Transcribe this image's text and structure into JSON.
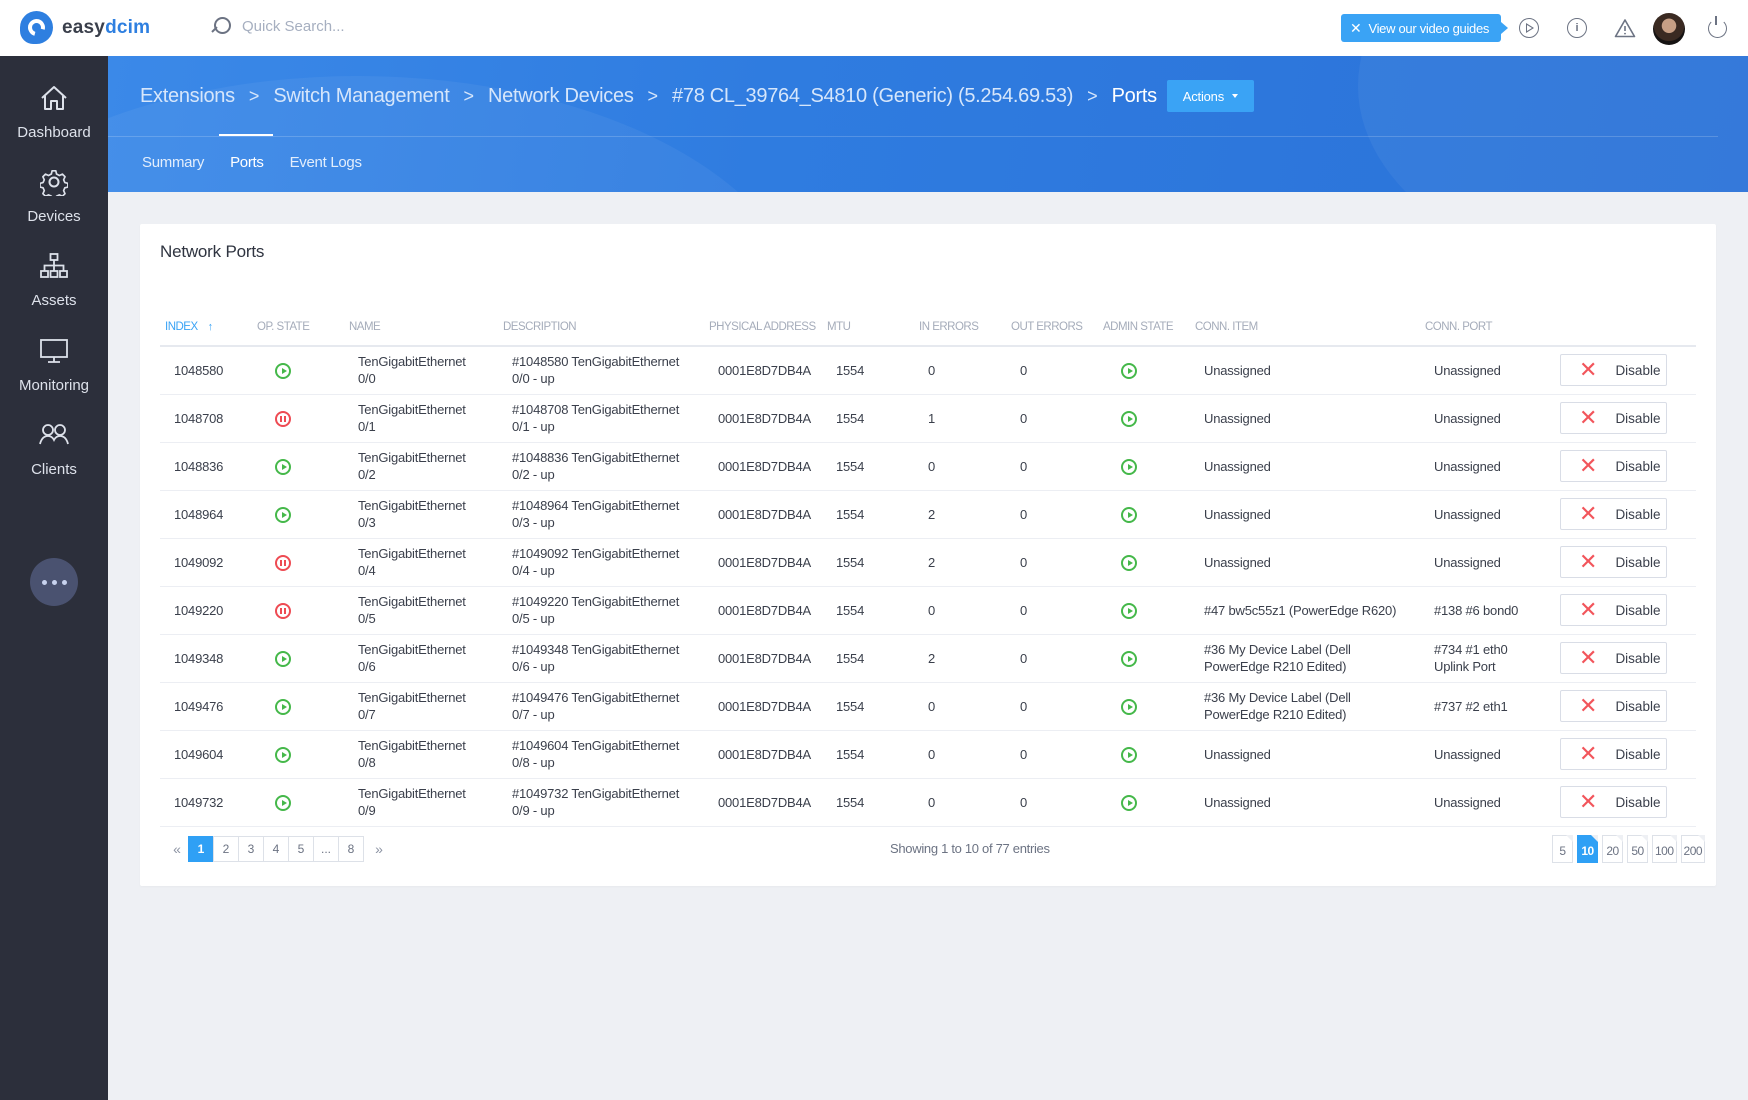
{
  "app": {
    "logo_text_a": "easy",
    "logo_text_b": "dcim",
    "search_placeholder": "Quick Search...",
    "guide_bubble": "View our video guides"
  },
  "sidebar": {
    "items": [
      {
        "label": "Dashboard",
        "icon": "home-icon"
      },
      {
        "label": "Devices",
        "icon": "gear-icon"
      },
      {
        "label": "Assets",
        "icon": "hierarchy-icon"
      },
      {
        "label": "Monitoring",
        "icon": "monitor-icon"
      },
      {
        "label": "Clients",
        "icon": "users-icon"
      }
    ],
    "more_icon": "more-dots-icon"
  },
  "breadcrumb": [
    "Extensions",
    "Switch Management",
    "Network Devices",
    "#78 CL_39764_S4810 (Generic) (5.254.69.53)",
    "Ports"
  ],
  "actions_label": "Actions",
  "tabs": [
    {
      "label": "Summary",
      "active": false
    },
    {
      "label": "Ports",
      "active": true
    },
    {
      "label": "Event Logs",
      "active": false
    }
  ],
  "card": {
    "title": "Network Ports"
  },
  "table": {
    "columns": [
      "Index",
      "Op. State",
      "Name",
      "Description",
      "Physical Address",
      "MTU",
      "In Errors",
      "Out Errors",
      "Admin State",
      "Conn. Item",
      "Conn. Port",
      ""
    ],
    "sort_column": "Index",
    "sort_direction": "asc",
    "rows": [
      {
        "index": "1048580",
        "op_state": "up",
        "name_a": "TenGigabitEthernet",
        "name_b": "0/0",
        "desc_a": "#1048580 TenGigabitEthernet",
        "desc_b": "0/0 - up",
        "mac": "0001E8D7DB4A",
        "mtu": "1554",
        "in_err": "0",
        "out_err": "0",
        "admin_state": "up",
        "conn_item_a": "Unassigned",
        "conn_item_b": "",
        "conn_port_a": "Unassigned",
        "conn_port_b": "",
        "action": "Disable"
      },
      {
        "index": "1048708",
        "op_state": "down",
        "name_a": "TenGigabitEthernet",
        "name_b": "0/1",
        "desc_a": "#1048708 TenGigabitEthernet",
        "desc_b": "0/1 - up",
        "mac": "0001E8D7DB4A",
        "mtu": "1554",
        "in_err": "1",
        "out_err": "0",
        "admin_state": "up",
        "conn_item_a": "Unassigned",
        "conn_item_b": "",
        "conn_port_a": "Unassigned",
        "conn_port_b": "",
        "action": "Disable"
      },
      {
        "index": "1048836",
        "op_state": "up",
        "name_a": "TenGigabitEthernet",
        "name_b": "0/2",
        "desc_a": "#1048836 TenGigabitEthernet",
        "desc_b": "0/2 - up",
        "mac": "0001E8D7DB4A",
        "mtu": "1554",
        "in_err": "0",
        "out_err": "0",
        "admin_state": "up",
        "conn_item_a": "Unassigned",
        "conn_item_b": "",
        "conn_port_a": "Unassigned",
        "conn_port_b": "",
        "action": "Disable"
      },
      {
        "index": "1048964",
        "op_state": "up",
        "name_a": "TenGigabitEthernet",
        "name_b": "0/3",
        "desc_a": "#1048964 TenGigabitEthernet",
        "desc_b": "0/3 - up",
        "mac": "0001E8D7DB4A",
        "mtu": "1554",
        "in_err": "2",
        "out_err": "0",
        "admin_state": "up",
        "conn_item_a": "Unassigned",
        "conn_item_b": "",
        "conn_port_a": "Unassigned",
        "conn_port_b": "",
        "action": "Disable"
      },
      {
        "index": "1049092",
        "op_state": "down",
        "name_a": "TenGigabitEthernet",
        "name_b": "0/4",
        "desc_a": "#1049092 TenGigabitEthernet",
        "desc_b": "0/4 - up",
        "mac": "0001E8D7DB4A",
        "mtu": "1554",
        "in_err": "2",
        "out_err": "0",
        "admin_state": "up",
        "conn_item_a": "Unassigned",
        "conn_item_b": "",
        "conn_port_a": "Unassigned",
        "conn_port_b": "",
        "action": "Disable"
      },
      {
        "index": "1049220",
        "op_state": "down",
        "name_a": "TenGigabitEthernet",
        "name_b": "0/5",
        "desc_a": "#1049220 TenGigabitEthernet",
        "desc_b": "0/5 - up",
        "mac": "0001E8D7DB4A",
        "mtu": "1554",
        "in_err": "0",
        "out_err": "0",
        "admin_state": "up",
        "conn_item_a": "#47 bw5c55z1 (PowerEdge R620)",
        "conn_item_b": "",
        "conn_port_a": "#138 #6 bond0",
        "conn_port_b": "",
        "action": "Disable"
      },
      {
        "index": "1049348",
        "op_state": "up",
        "name_a": "TenGigabitEthernet",
        "name_b": "0/6",
        "desc_a": "#1049348 TenGigabitEthernet",
        "desc_b": "0/6 - up",
        "mac": "0001E8D7DB4A",
        "mtu": "1554",
        "in_err": "2",
        "out_err": "0",
        "admin_state": "up",
        "conn_item_a": "#36 My Device Label (Dell",
        "conn_item_b": "PowerEdge R210 Edited)",
        "conn_port_a": "#734 #1 eth0",
        "conn_port_b": "Uplink Port",
        "action": "Disable"
      },
      {
        "index": "1049476",
        "op_state": "up",
        "name_a": "TenGigabitEthernet",
        "name_b": "0/7",
        "desc_a": "#1049476 TenGigabitEthernet",
        "desc_b": "0/7 - up",
        "mac": "0001E8D7DB4A",
        "mtu": "1554",
        "in_err": "0",
        "out_err": "0",
        "admin_state": "up",
        "conn_item_a": "#36 My Device Label (Dell",
        "conn_item_b": "PowerEdge R210 Edited)",
        "conn_port_a": "#737 #2 eth1",
        "conn_port_b": "",
        "action": "Disable"
      },
      {
        "index": "1049604",
        "op_state": "up",
        "name_a": "TenGigabitEthernet",
        "name_b": "0/8",
        "desc_a": "#1049604 TenGigabitEthernet",
        "desc_b": "0/8 - up",
        "mac": "0001E8D7DB4A",
        "mtu": "1554",
        "in_err": "0",
        "out_err": "0",
        "admin_state": "up",
        "conn_item_a": "Unassigned",
        "conn_item_b": "",
        "conn_port_a": "Unassigned",
        "conn_port_b": "",
        "action": "Disable"
      },
      {
        "index": "1049732",
        "op_state": "up",
        "name_a": "TenGigabitEthernet",
        "name_b": "0/9",
        "desc_a": "#1049732 TenGigabitEthernet",
        "desc_b": "0/9 - up",
        "mac": "0001E8D7DB4A",
        "mtu": "1554",
        "in_err": "0",
        "out_err": "0",
        "admin_state": "up",
        "conn_item_a": "Unassigned",
        "conn_item_b": "",
        "conn_port_a": "Unassigned",
        "conn_port_b": "",
        "action": "Disable"
      }
    ]
  },
  "pagination": {
    "prev": "«",
    "next": "»",
    "pages": [
      "1",
      "2",
      "3",
      "4",
      "5",
      "...",
      "8"
    ],
    "current": "1",
    "info": "Showing 1 to 10 of 77 entries",
    "per_page_options": [
      "5",
      "10",
      "20",
      "50",
      "100",
      "200"
    ],
    "per_page_current": "10"
  },
  "colors": {
    "accent": "#3aa3f5",
    "header_blue": "#2f7ce0",
    "sidebar_bg": "#2c2f3b",
    "state_up": "#45b84a",
    "state_down": "#ee4b53"
  }
}
